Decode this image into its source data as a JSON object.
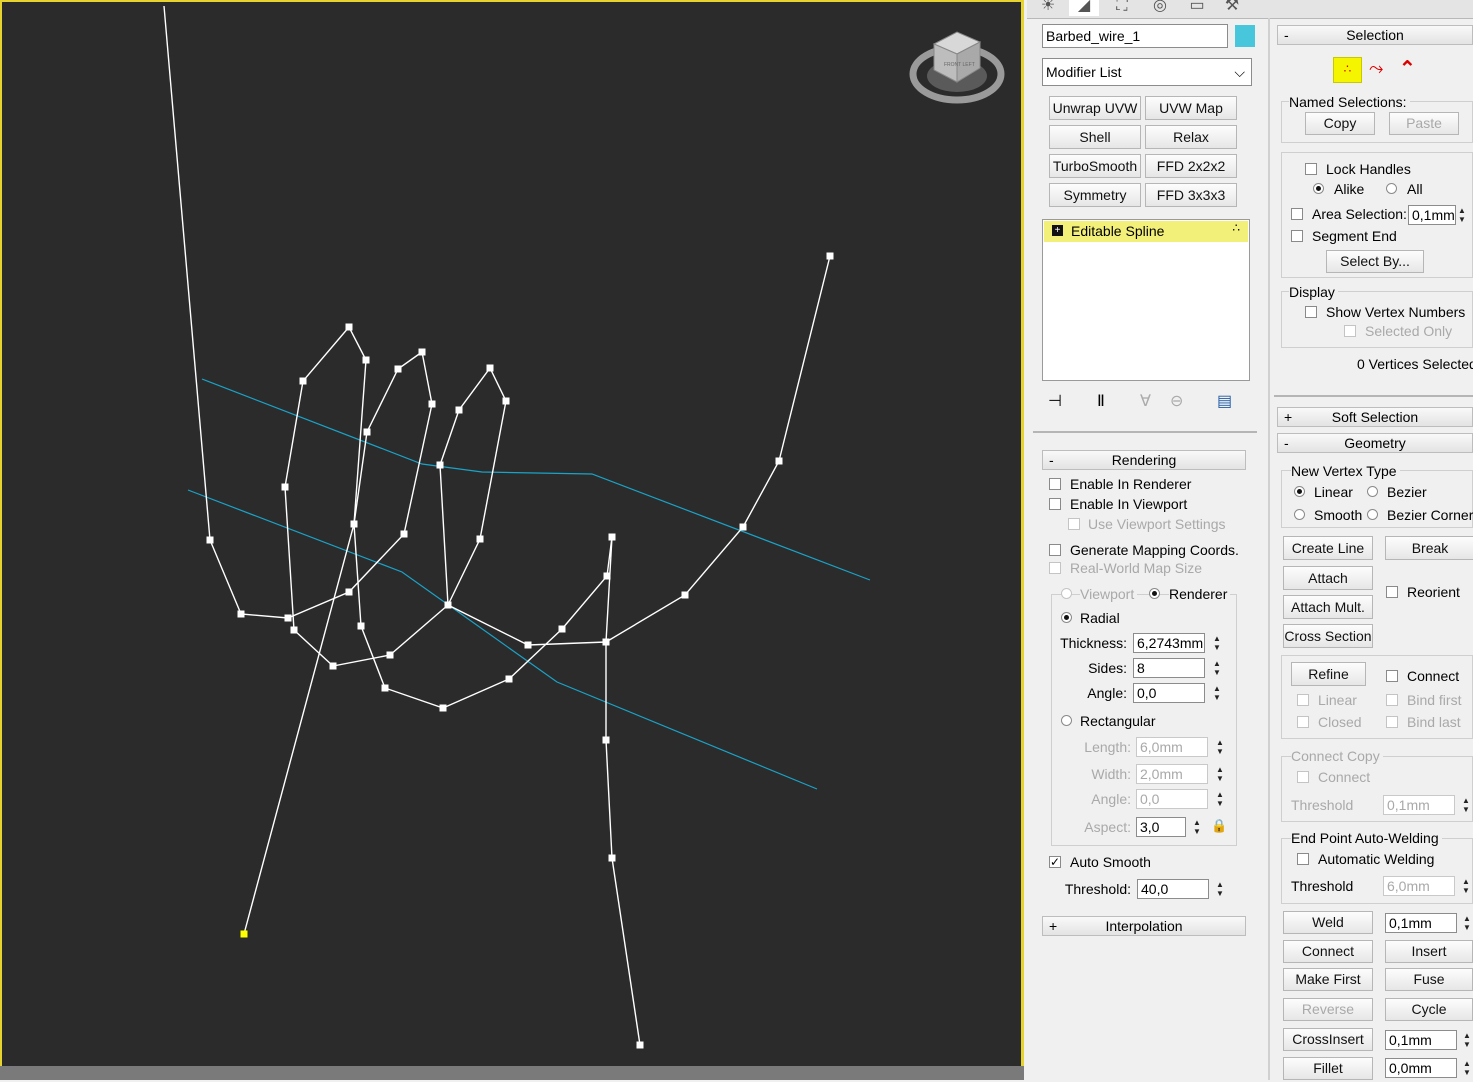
{
  "colors": {
    "accent_yellow": "#e7d32f",
    "viewport_bg": "#2b2b2b",
    "spline_white": "#ffffff",
    "guide_cyan": "#1aa3c8",
    "object_color": "#48c6dc",
    "selected_vertex": "#ffff00"
  },
  "viewport": {
    "viewcube_label": "FRONT LEFT"
  },
  "command_panel": {
    "tab_icons": [
      "create-tab-icon",
      "modify-tab-icon",
      "hierarchy-tab-icon",
      "motion-tab-icon",
      "display-tab-icon",
      "utilities-tab-icon"
    ],
    "object_name": "Barbed_wire_1",
    "modifier_list": "Modifier List",
    "modifier_buttons": [
      "Unwrap UVW",
      "UVW Map",
      "Shell",
      "Relax",
      "TurboSmooth",
      "FFD 2x2x2",
      "Symmetry",
      "FFD 3x3x3"
    ],
    "stack_item": "Editable Spline",
    "stack_icons": [
      "pin-stack-icon",
      "show-end-result-icon",
      "make-unique-icon",
      "remove-modifier-icon",
      "configure-modifier-sets-icon"
    ]
  },
  "rendering": {
    "title": "Rendering",
    "enable_in_renderer": "Enable In Renderer",
    "enable_in_viewport": "Enable In Viewport",
    "use_viewport_settings": "Use Viewport Settings",
    "generate_mapping": "Generate Mapping Coords.",
    "real_world_map": "Real-World Map Size",
    "viewport": "Viewport",
    "renderer": "Renderer",
    "radial": "Radial",
    "thickness_label": "Thickness:",
    "thickness": "6,2743mm",
    "sides_label": "Sides:",
    "sides": "8",
    "angle_label": "Angle:",
    "angle": "0,0",
    "rectangular": "Rectangular",
    "length_label": "Length:",
    "length": "6,0mm",
    "width_label": "Width:",
    "width": "2,0mm",
    "angle2_label": "Angle:",
    "angle2": "0,0",
    "aspect_label": "Aspect:",
    "aspect": "3,0",
    "auto_smooth": "Auto Smooth",
    "threshold_label": "Threshold:",
    "threshold": "40,0",
    "interpolation": "Interpolation"
  },
  "selection": {
    "title": "Selection",
    "named_selections": "Named Selections:",
    "copy": "Copy",
    "paste": "Paste",
    "lock_handles": "Lock Handles",
    "alike": "Alike",
    "all": "All",
    "area_selection": "Area Selection:",
    "area_value": "0,1mm",
    "segment_end": "Segment End",
    "select_by": "Select By...",
    "display": "Display",
    "show_vertex_numbers": "Show Vertex Numbers",
    "selected_only": "Selected Only",
    "status": "0 Vertices Selected"
  },
  "soft_selection": {
    "title": "Soft Selection"
  },
  "geometry": {
    "title": "Geometry",
    "new_vertex_type": "New Vertex Type",
    "linear": "Linear",
    "bezier": "Bezier",
    "smooth": "Smooth",
    "bezier_corner": "Bezier Corner",
    "create_line": "Create Line",
    "break": "Break",
    "attach": "Attach",
    "attach_mult": "Attach Mult.",
    "reorient": "Reorient",
    "cross_section": "Cross Section",
    "refine": "Refine",
    "connect": "Connect",
    "linear2": "Linear",
    "bind_first": "Bind first",
    "closed": "Closed",
    "bind_last": "Bind last",
    "connect_copy": "Connect Copy",
    "cc_connect": "Connect",
    "cc_threshold": "Threshold",
    "cc_value": "0,1mm",
    "end_point_welding": "End Point Auto-Welding",
    "automatic_welding": "Automatic Welding",
    "ep_threshold": "Threshold",
    "ep_value": "6,0mm",
    "weld": "Weld",
    "weld_value": "0,1mm",
    "connect_btn": "Connect",
    "insert": "Insert",
    "make_first": "Make First",
    "fuse": "Fuse",
    "reverse": "Reverse",
    "cycle": "Cycle",
    "cross_insert": "CrossInsert",
    "cross_insert_value": "0,1mm",
    "fillet": "Fillet",
    "fillet_value": "0,0mm"
  }
}
